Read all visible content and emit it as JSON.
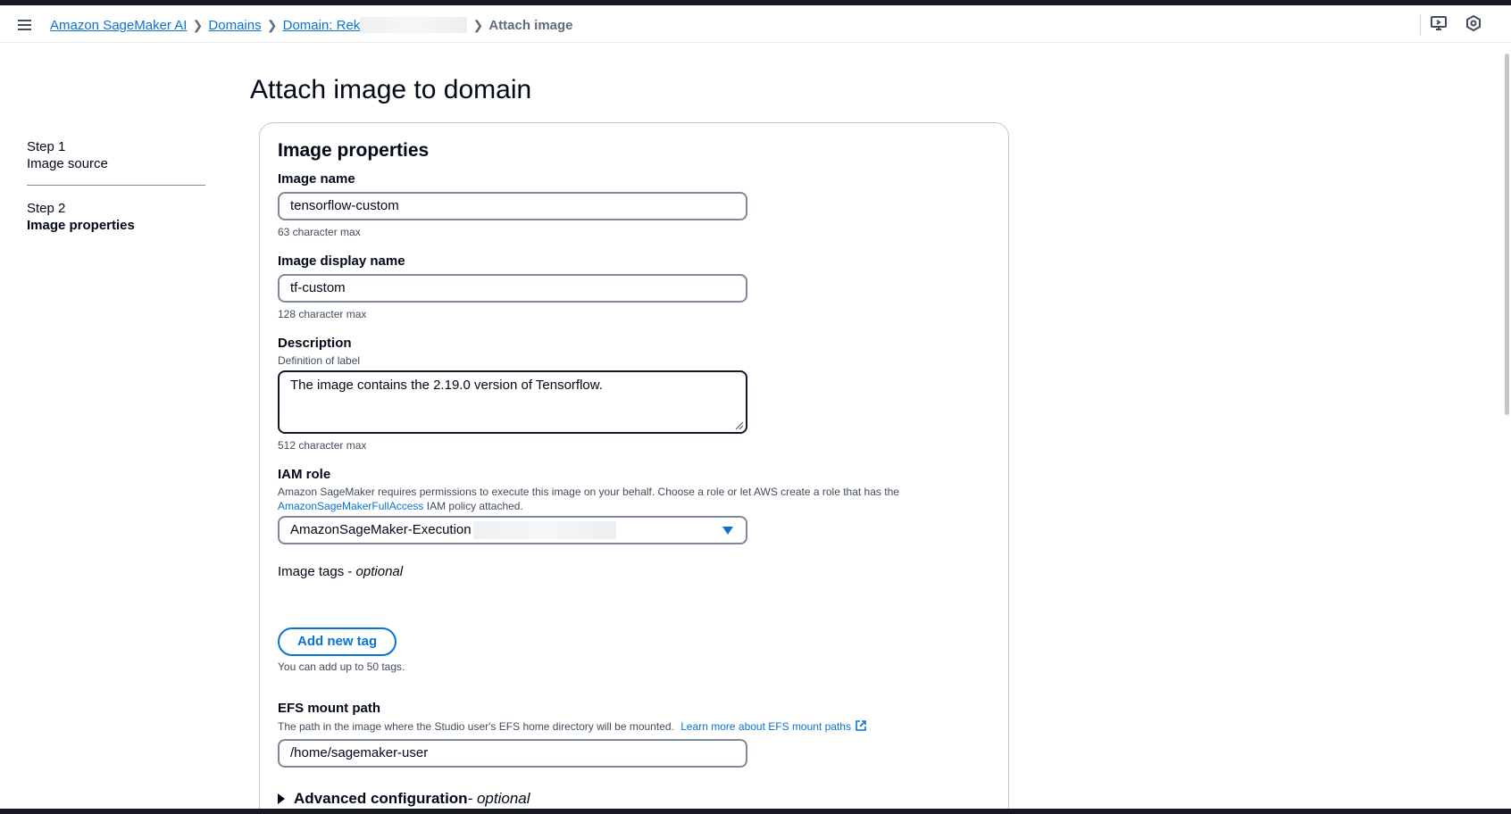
{
  "breadcrumbs": {
    "items": [
      "Amazon SageMaker AI",
      "Domains",
      "Domain: Rek"
    ],
    "current": "Attach image"
  },
  "steps": [
    {
      "number": "Step 1",
      "label": "Image source"
    },
    {
      "number": "Step 2",
      "label": "Image properties"
    }
  ],
  "page": {
    "title": "Attach image to domain"
  },
  "container": {
    "header": "Image properties"
  },
  "image_name": {
    "label": "Image name",
    "value": "tensorflow-custom",
    "hint": "63 character max"
  },
  "display_name": {
    "label": "Image display name",
    "value": "tf-custom",
    "hint": "128 character max"
  },
  "description": {
    "label": "Description",
    "sublabel": "Definition of label",
    "value": "The image contains the 2.19.0 version of Tensorflow.",
    "hint": "512 character max"
  },
  "iam_role": {
    "label": "IAM role",
    "desc_before": "Amazon SageMaker requires permissions to execute this image on your behalf. Choose a role or let AWS create a role that has the",
    "policy_link": "AmazonSageMakerFullAccess",
    "desc_after": " IAM policy attached.",
    "selected": "AmazonSageMaker-Execution"
  },
  "tags": {
    "label": "Image tags - ",
    "optional": "optional",
    "add_button": "Add new tag",
    "hint": "You can add up to 50 tags."
  },
  "efs": {
    "label": "EFS mount path",
    "desc": "The path in the image where the Studio user's EFS home directory will be mounted.",
    "learn_more": "Learn more about EFS mount paths",
    "value": "/home/sagemaker-user"
  },
  "advanced": {
    "label": "Advanced configuration",
    "optional": " - optional"
  },
  "colors": {
    "link": "#0972d3",
    "text": "#000716",
    "border": "#7d8998"
  }
}
